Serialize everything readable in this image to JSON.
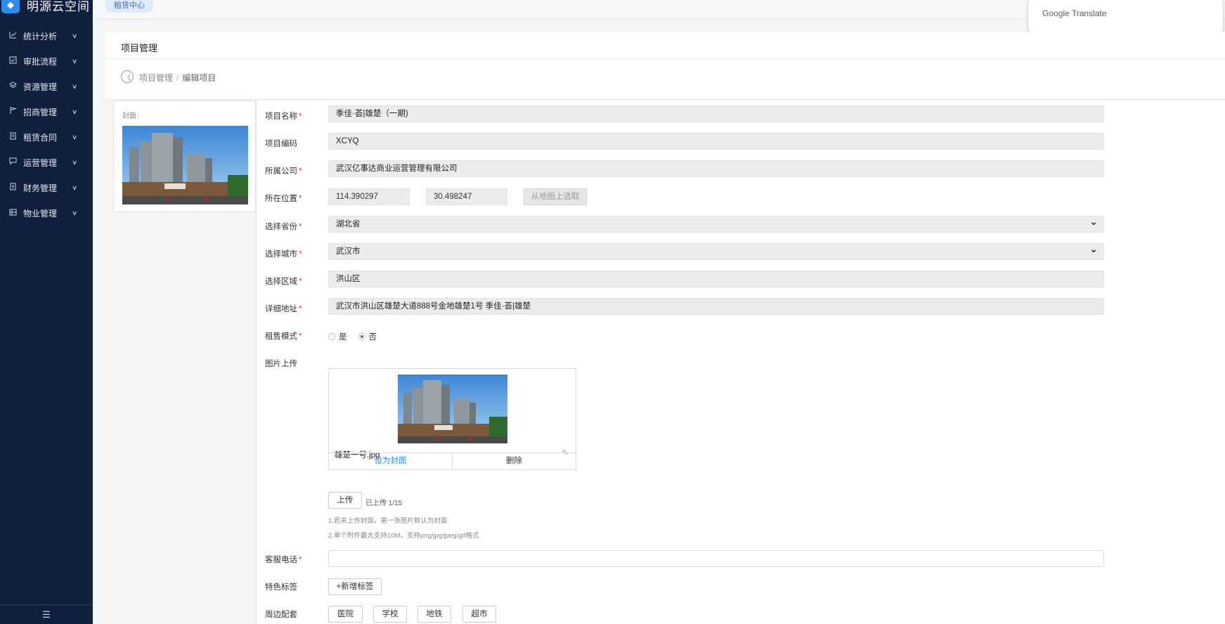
{
  "app": {
    "logo_text": "明源云空间"
  },
  "topbar": {
    "tag": "租赁中心"
  },
  "translate": {
    "brand": "Google",
    "label": "Translate"
  },
  "sidebar": {
    "items": [
      {
        "label": "统计分析",
        "icon": "chart-icon"
      },
      {
        "label": "审批流程",
        "icon": "checklist-icon"
      },
      {
        "label": "资源管理",
        "icon": "layers-icon"
      },
      {
        "label": "招商管理",
        "icon": "flag-icon"
      },
      {
        "label": "租赁合同",
        "icon": "contract-icon"
      },
      {
        "label": "运营管理",
        "icon": "message-icon"
      },
      {
        "label": "财务管理",
        "icon": "finance-icon"
      },
      {
        "label": "物业管理",
        "icon": "building-icon"
      }
    ],
    "footer_icon": "menu-collapse-icon"
  },
  "page": {
    "title": "项目管理",
    "breadcrumb": {
      "parent": "项目管理",
      "separator": "/",
      "current": "编辑项目"
    }
  },
  "cover": {
    "label": "封面:"
  },
  "form": {
    "name": {
      "label": "项目名称",
      "value": "季佳·荟|雄楚（一期)"
    },
    "code": {
      "label": "项目编码",
      "value": "XCYQ"
    },
    "company": {
      "label": "所属公司",
      "value": "武汉亿事达商业运营管理有限公司"
    },
    "location": {
      "label": "所在位置",
      "lng": "114.390297",
      "lat": "30.498247",
      "map_button": "从地图上选取"
    },
    "province": {
      "label": "选择省份",
      "value": "湖北省"
    },
    "city": {
      "label": "选择城市",
      "value": "武汉市"
    },
    "district": {
      "label": "选择区域",
      "value": "洪山区"
    },
    "address": {
      "label": "详细地址",
      "value": "武汉市洪山区雄楚大道888号金地雄楚1号 季佳·荟|雄楚"
    },
    "sale_mode": {
      "label": "租售模式",
      "options": [
        "是",
        "否"
      ],
      "selected": "否"
    },
    "images": {
      "label": "图片上传",
      "file_name": "雄楚一号.jpg",
      "set_cover": "设为封面",
      "delete": "删除",
      "upload_button": "上传",
      "upload_count": "已上传 1/15",
      "hint1": "1.若未上传封面，第一张图片默认为封面",
      "hint2": "2.单个附件最大支持10M，支持png/jpg/jpeg/gif格式"
    },
    "phone": {
      "label": "客服电话",
      "value": ""
    },
    "feature_tags": {
      "label": "特色标签",
      "add_button": "+新增标签"
    },
    "surroundings": {
      "label": "周边配套",
      "tags": [
        "医院",
        "学校",
        "地铁",
        "超市"
      ]
    }
  }
}
